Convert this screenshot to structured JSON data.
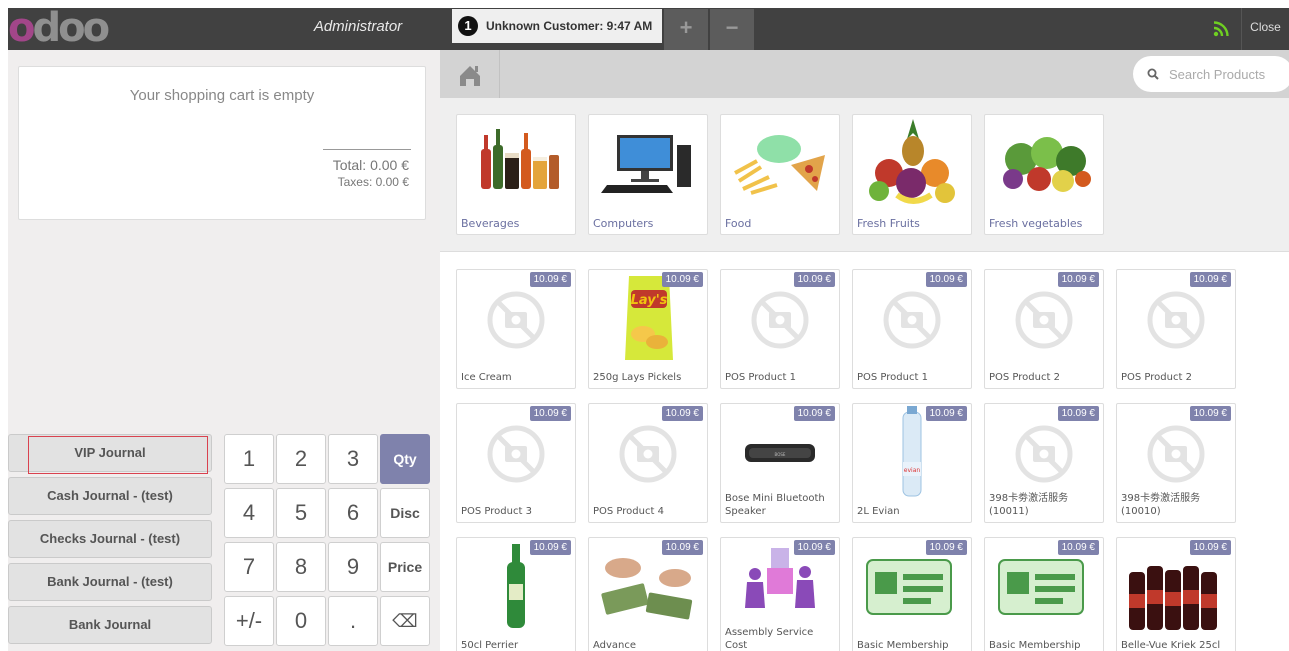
{
  "header": {
    "logo_text": "odoo",
    "user_name": "Administrator",
    "order_number": "1",
    "order_label": "Unknown Customer: 9:47 AM",
    "add_order_symbol": "+",
    "remove_order_symbol": "−",
    "close_label": "Close"
  },
  "cart": {
    "empty_message": "Your shopping cart is empty",
    "total": "Total: 0.00 €",
    "taxes": "Taxes: 0.00 €"
  },
  "journals": [
    {
      "label": "VIP Journal",
      "highlighted": true
    },
    {
      "label": "Cash Journal - (test)"
    },
    {
      "label": "Checks Journal - (test)"
    },
    {
      "label": "Bank Journal - (test)"
    },
    {
      "label": "Bank Journal"
    }
  ],
  "numpad": {
    "keys": [
      "1",
      "2",
      "3",
      "4",
      "5",
      "6",
      "7",
      "8",
      "9",
      "+/-",
      "0",
      "."
    ],
    "modes": [
      "Qty",
      "Disc",
      "Price"
    ],
    "active_mode": "Qty",
    "backspace_icon": "⌫"
  },
  "search": {
    "placeholder": "Search Products"
  },
  "categories": [
    {
      "name": "Beverages",
      "icon": "beverages"
    },
    {
      "name": "Computers",
      "icon": "computer"
    },
    {
      "name": "Food",
      "icon": "food"
    },
    {
      "name": "Fresh Fruits",
      "icon": "fruits"
    },
    {
      "name": "Fresh vegetables",
      "icon": "vegetables"
    }
  ],
  "products": [
    {
      "name": "Ice Cream",
      "price": "10.09 €",
      "image": "placeholder"
    },
    {
      "name": "250g Lays Pickels",
      "price": "10.09 €",
      "image": "chips"
    },
    {
      "name": "POS Product 1",
      "price": "10.09 €",
      "image": "placeholder"
    },
    {
      "name": "POS Product 1",
      "price": "10.09 €",
      "image": "placeholder"
    },
    {
      "name": "POS Product 2",
      "price": "10.09 €",
      "image": "placeholder"
    },
    {
      "name": "POS Product 2",
      "price": "10.09 €",
      "image": "placeholder"
    },
    {
      "name": "POS Product 3",
      "price": "10.09 €",
      "image": "placeholder"
    },
    {
      "name": "POS Product 4",
      "price": "10.09 €",
      "image": "placeholder"
    },
    {
      "name": "Bose Mini Bluetooth Speaker",
      "price": "10.09 €",
      "image": "speaker"
    },
    {
      "name": "2L Evian",
      "price": "10.09 €",
      "image": "water"
    },
    {
      "name": "398卡劵激活服务 (10011)",
      "price": "10.09 €",
      "image": "placeholder"
    },
    {
      "name": "398卡劵激活服务 (10010)",
      "price": "10.09 €",
      "image": "placeholder"
    },
    {
      "name": "50cl Perrier",
      "price": "10.09 €",
      "image": "bottle"
    },
    {
      "name": "Advance",
      "price": "10.09 €",
      "image": "money"
    },
    {
      "name": "Assembly Service Cost",
      "price": "10.09 €",
      "image": "puzzle"
    },
    {
      "name": "Basic Membership",
      "price": "10.09 €",
      "image": "card"
    },
    {
      "name": "Basic Membership",
      "price": "10.09 €",
      "image": "card"
    },
    {
      "name": "Belle-Vue Kriek 25cl",
      "price": "10.09 €",
      "image": "beer"
    }
  ],
  "colors": {
    "topbar": "#414141",
    "accent": "#7f82ac",
    "highlight_border": "#d9424f"
  }
}
